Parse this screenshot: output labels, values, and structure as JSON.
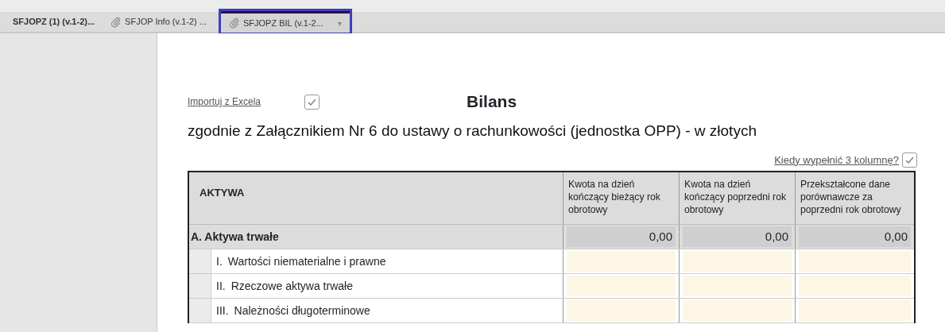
{
  "tabs": [
    {
      "label": "SFJOPZ (1) (v.1-2)...",
      "attachment": false,
      "dropdown": false,
      "selected": false
    },
    {
      "label": "SFJOP Info (v.1-2) ...",
      "attachment": true,
      "dropdown": false,
      "selected": false
    },
    {
      "label": "SFJOPZ BIL (v.1-2...",
      "attachment": true,
      "dropdown": true,
      "selected": true
    }
  ],
  "dropdown_glyph": "▾",
  "import_link": {
    "label": "Importuj z Excela",
    "checked": true
  },
  "title": "Bilans",
  "subtitle": "zgodnie z Załącznikiem Nr 6 do ustawy o rachunkowości (jednostka OPP) - w złotych",
  "help_link": {
    "label": "Kiedy wypełnić 3 kolumnę?",
    "checked": true
  },
  "table": {
    "columns": [
      "AKTYWA",
      "Kwota na dzień kończący bieżący rok obrotowy",
      "Kwota na dzień kończący poprzedni rok obrotowy",
      "Przekształcone dane porównawcze za poprzedni rok obrotowy"
    ],
    "rows": [
      {
        "kind": "section",
        "label": "A. Aktywa trwałe",
        "values": [
          "0,00",
          "0,00",
          "0,00"
        ]
      },
      {
        "kind": "item",
        "number": "I.",
        "label": "Wartości niematerialne i prawne"
      },
      {
        "kind": "item",
        "number": "II.",
        "label": "Rzeczowe aktywa trwałe"
      },
      {
        "kind": "item",
        "number": "III.",
        "label": "Należności długoterminowe"
      }
    ]
  }
}
